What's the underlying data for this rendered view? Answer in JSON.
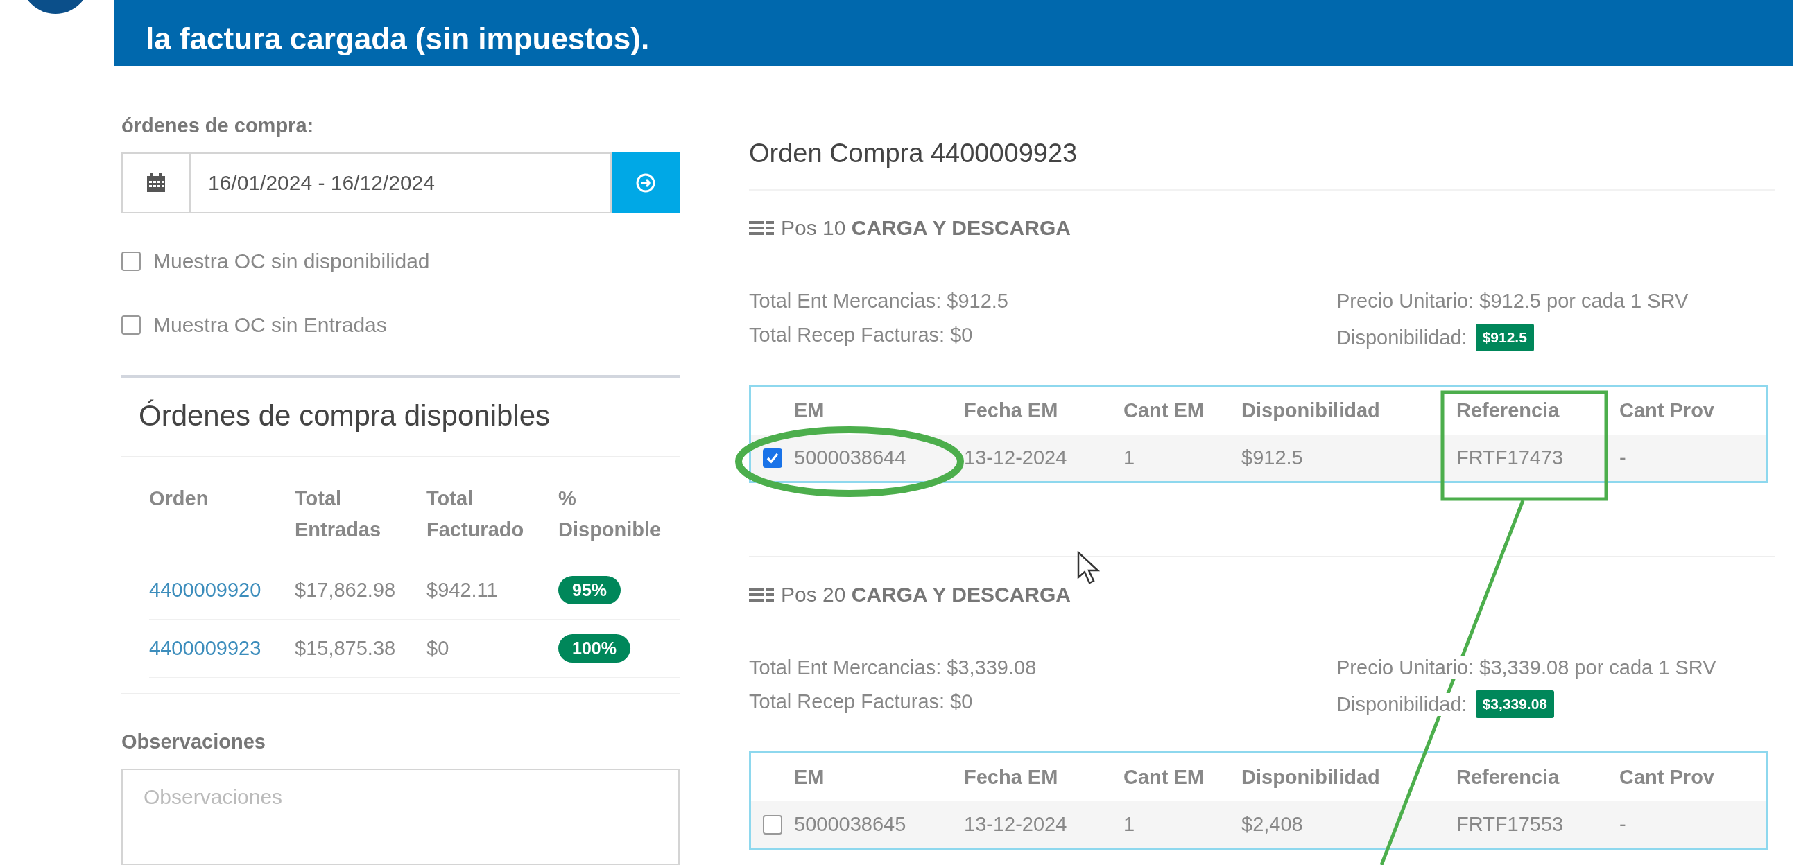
{
  "banner": {
    "text": "la factura cargada (sin impuestos)."
  },
  "filter": {
    "label": "órdenes de compra:",
    "date_range": "16/01/2024 - 16/12/2024",
    "options": [
      {
        "label": "Muestra OC sin disponibilidad",
        "checked": false
      },
      {
        "label": "Muestra OC sin Entradas",
        "checked": false
      }
    ]
  },
  "orders": {
    "title": "Órdenes de compra disponibles",
    "columns": [
      "Orden",
      "Total Entradas",
      "Total Facturado",
      "% Disponible"
    ],
    "rows": [
      {
        "order": "4400009920",
        "total_entradas": "$17,862.98",
        "total_facturado": "$942.11",
        "disponible": "95%"
      },
      {
        "order": "4400009923",
        "total_entradas": "$15,875.38",
        "total_facturado": "$0",
        "disponible": "100%"
      }
    ]
  },
  "observations": {
    "label": "Observaciones",
    "placeholder": "Observaciones"
  },
  "order_detail": {
    "title": "Orden Compra 4400009923",
    "positions": [
      {
        "heading": "Pos 10 **CARGA Y DESCARGA**",
        "total_ent": "Total Ent Mercancias: $912.5",
        "total_recep": "Total Recep Facturas: $0",
        "unit_price": "Precio Unitario: $912.5 por cada 1 SRV",
        "availability_label": "Disponibilidad:",
        "availability": "$912.5",
        "columns": [
          "EM",
          "Fecha EM",
          "Cant EM",
          "Disponibilidad",
          "Referencia",
          "Cant Prov"
        ],
        "rows": [
          {
            "checked": true,
            "cells": [
              "5000038644",
              "13-12-2024",
              "1",
              "$912.5",
              "FRTF17473",
              "-"
            ]
          }
        ]
      },
      {
        "heading": "Pos 20 **CARGA Y DESCARGA**",
        "total_ent": "Total Ent Mercancias: $3,339.08",
        "total_recep": "Total Recep Facturas: $0",
        "unit_price": "Precio Unitario: $3,339.08 por cada 1 SRV",
        "availability_label": "Disponibilidad:",
        "availability": "$3,339.08",
        "columns": [
          "EM",
          "Fecha EM",
          "Cant EM",
          "Disponibilidad",
          "Referencia",
          "Cant Prov"
        ],
        "rows": [
          {
            "checked": false,
            "cells": [
              "5000038645",
              "13-12-2024",
              "1",
              "$2,408",
              "FRTF17553",
              "-"
            ]
          }
        ]
      }
    ]
  }
}
